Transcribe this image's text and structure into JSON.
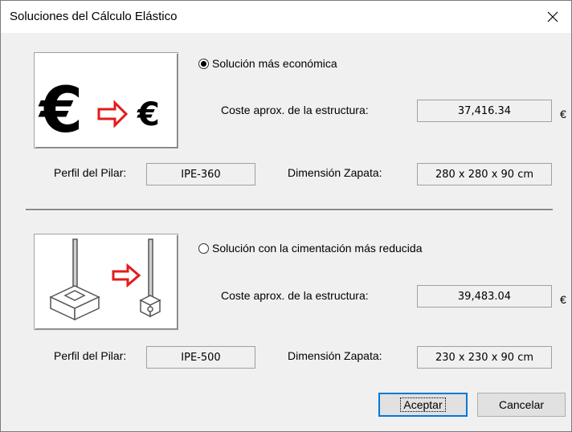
{
  "window": {
    "title": "Soluciones del Cálculo Elástico"
  },
  "option1": {
    "radio_label": "Solución más económica",
    "selected": true,
    "cost_label": "Coste aprox. de la estructura:",
    "cost_value": "37,416.34",
    "currency": "€",
    "pilar_label": "Perfil del Pilar:",
    "pilar_value": "IPE-360",
    "zapata_label": "Dimensión Zapata:",
    "zapata_value": "280 x 280 x 90 cm",
    "image_big_euro": "€",
    "image_small_euro": "€"
  },
  "option2": {
    "radio_label": "Solución con la cimentación más reducida",
    "selected": false,
    "cost_label": "Coste aprox. de la estructura:",
    "cost_value": "39,483.04",
    "currency": "€",
    "pilar_label": "Perfil del Pilar:",
    "pilar_value": "IPE-500",
    "zapata_label": "Dimensión Zapata:",
    "zapata_value": "230 x 230 x 90 cm"
  },
  "buttons": {
    "accept": "Aceptar",
    "cancel": "Cancelar"
  },
  "colors": {
    "arrow": "#e31b1b",
    "focus": "#0078d7"
  }
}
